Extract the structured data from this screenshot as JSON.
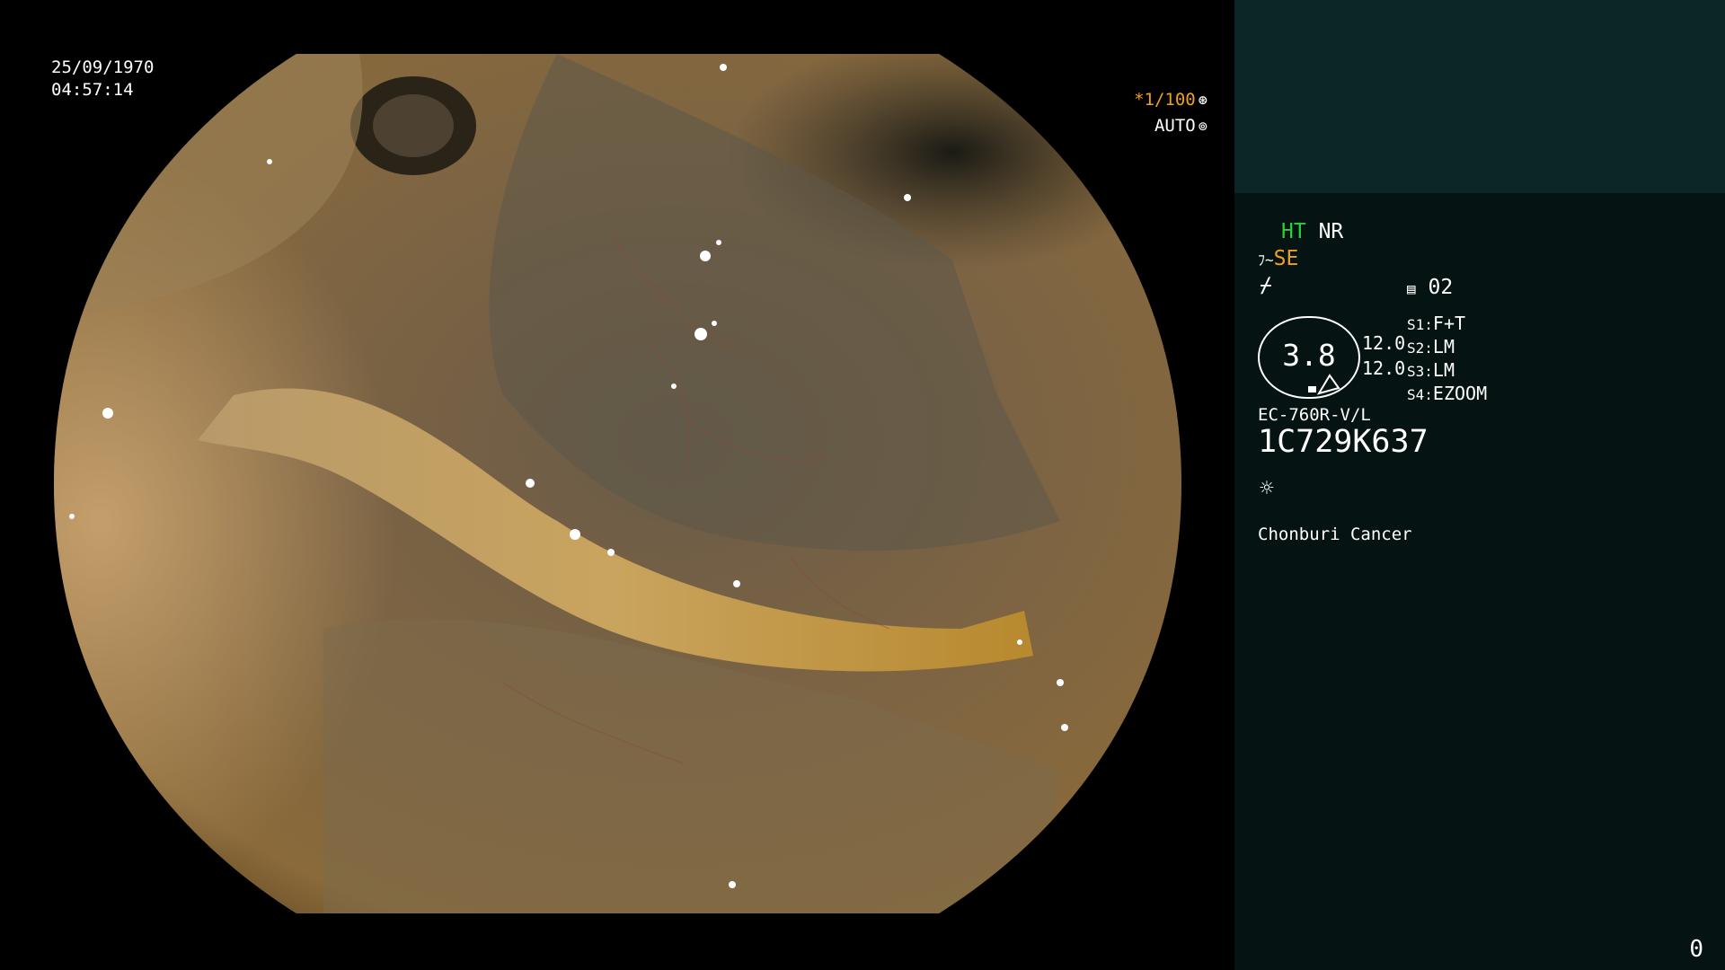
{
  "overlay": {
    "date": "25/09/1970",
    "time": "04:57:14",
    "shutter": "*1/100",
    "shutter_icon": "shutter-icon",
    "iris_mode": "AUTO",
    "iris_icon": "iris-icon"
  },
  "panel": {
    "mode_ht": "HT",
    "mode_nr": "NR",
    "mode_se": "SE",
    "memory": "02",
    "zoom_value": "3.8",
    "zoom_upper": "12.0",
    "zoom_lower": "12.0",
    "switches": [
      {
        "key": "S1:",
        "value": "F+T"
      },
      {
        "key": "S2:",
        "value": "LM"
      },
      {
        "key": "S3:",
        "value": "LM"
      },
      {
        "key": "S4:",
        "value": "EZOOM"
      }
    ],
    "scope_model": "EC-760R-V/L",
    "scope_serial": "1C729K637",
    "light_icon": "sun-icon",
    "institution": "Chonburi Cancer",
    "counter": "0"
  },
  "colors": {
    "panel_bg": "#051412",
    "panel_top_bg": "#0c2627",
    "accent_green": "#28d23c",
    "accent_orange": "#f0a020"
  }
}
